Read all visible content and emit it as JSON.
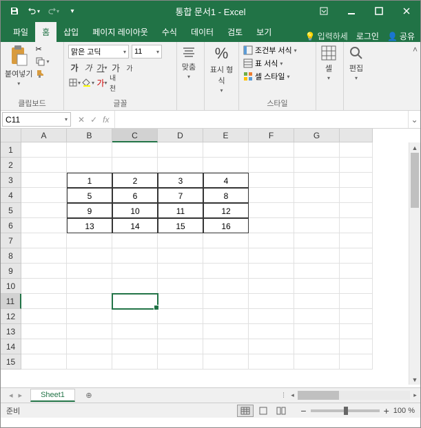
{
  "titlebar": {
    "title": "통합 문서1 - Excel"
  },
  "tabs": {
    "file": "파일",
    "home": "홈",
    "insert": "삽입",
    "page_layout": "페이지 레이아웃",
    "formulas": "수식",
    "data": "데이터",
    "review": "검토",
    "view": "보기",
    "search_placeholder": "입력하세",
    "login": "로그인",
    "share": "공유"
  },
  "ribbon": {
    "clipboard": {
      "label": "클립보드",
      "paste": "붙여넣기"
    },
    "font": {
      "label": "글꼴",
      "name": "맑은 고딕",
      "size": "11",
      "bold": "가",
      "italic": "가",
      "underline": "가",
      "inc": "가",
      "dec": "가",
      "phonetic": "내천"
    },
    "alignment": {
      "label": "맞춤"
    },
    "number": {
      "label": "표시 형식",
      "percent": "%"
    },
    "styles": {
      "label": "스타일",
      "conditional": "조건부 서식",
      "table": "표 서식",
      "cell": "셀 스타일"
    },
    "cells": {
      "label": "셀"
    },
    "editing": {
      "label": "편집"
    }
  },
  "namebox": {
    "value": "C11",
    "fx": "fx"
  },
  "columns": [
    "A",
    "B",
    "C",
    "D",
    "E",
    "F",
    "G",
    ""
  ],
  "rows": [
    "1",
    "2",
    "3",
    "4",
    "5",
    "6",
    "7",
    "8",
    "9",
    "10",
    "11",
    "12",
    "13",
    "14",
    "15"
  ],
  "active_cell": {
    "row": 11,
    "col": "C"
  },
  "cell_data": {
    "B3": "1",
    "C3": "2",
    "D3": "3",
    "E3": "4",
    "B4": "5",
    "C4": "6",
    "D4": "7",
    "E4": "8",
    "B5": "9",
    "C5": "10",
    "D5": "11",
    "E5": "12",
    "B6": "13",
    "C6": "14",
    "D6": "15",
    "E6": "16"
  },
  "sheets": {
    "tab1": "Sheet1"
  },
  "statusbar": {
    "ready": "준비",
    "zoom": "100 %"
  }
}
